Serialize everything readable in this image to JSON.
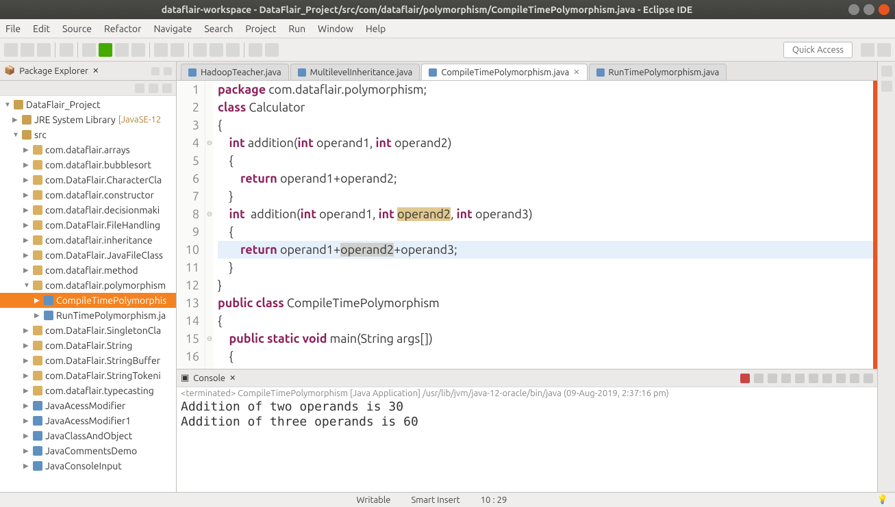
{
  "titlebar": {
    "title": "dataflair-workspace - DataFlair_Project/src/com/dataflair/polymorphism/CompileTimePolymorphism.java - Eclipse IDE"
  },
  "menubar": [
    "File",
    "Edit",
    "Source",
    "Refactor",
    "Navigate",
    "Search",
    "Project",
    "Run",
    "Window",
    "Help"
  ],
  "quick_access": "Quick Access",
  "package_explorer": {
    "title": "Package Explorer",
    "project": "DataFlair_Project",
    "jre": "JRE System Library",
    "jre_hint": "[JavaSE-12",
    "src": "src",
    "packages": [
      "com.dataflair.arrays",
      "com.dataflair.bubblesort",
      "com.DataFlair.CharacterCla",
      "com.dataflair.constructor",
      "com.dataflair.decisionmaki",
      "com.DataFlair.FileHandling",
      "com.dataflair.inheritance",
      "com.DataFlair.JavaFileClass",
      "com.dataflair.method",
      "com.dataflair.polymorphism"
    ],
    "polymorphism_files": [
      "CompileTimePolymorphis",
      "RunTimePolymorphism.ja"
    ],
    "packages_after": [
      "com.DataFlair.SingletonCla",
      "com.DataFlair.String",
      "com.DataFlair.StringBuffer",
      "com.DataFlair.StringTokeni",
      "com.dataflair.typecasting"
    ],
    "classes": [
      "JavaAcessModifier",
      "JavaAcessModifier1",
      "JavaClassAndObject",
      "JavaCommentsDemo",
      "JavaConsoleInput"
    ]
  },
  "editor": {
    "tabs": [
      {
        "label": "HadoopTeacher.java",
        "active": false
      },
      {
        "label": "MultilevelInheritance.java",
        "active": false
      },
      {
        "label": "CompileTimePolymorphism.java",
        "active": true
      },
      {
        "label": "RunTimePolymorphism.java",
        "active": false
      }
    ],
    "lines": [
      "1",
      "2",
      "3",
      "4",
      "5",
      "6",
      "7",
      "8",
      "9",
      "10",
      "11",
      "12",
      "13",
      "14",
      "15",
      "16"
    ],
    "code": {
      "l1_pkg": "package",
      "l1_path": "com.dataflair.polymorphism;",
      "l2_class": "class",
      "l2_name": "Calculator",
      "l3": "{",
      "l4_int": "int",
      "l4_m": "addition(",
      "l4_t1": "int",
      "l4_p1": " operand1, ",
      "l4_t2": "int",
      "l4_p2": " operand2)",
      "l5": "    {",
      "l6_ret": "return",
      "l6_expr": " operand1+operand2;",
      "l7": "    }",
      "l8_int": "int",
      "l8_m": " addition(",
      "l8_t1": "int",
      "l8_p1": " operand1, ",
      "l8_t2": "int",
      "l8_p2s": " ",
      "l8_p2": "operand2",
      "l8_c": ", ",
      "l8_t3": "int",
      "l8_p3": " operand3)",
      "l9": "    {",
      "l10_ret": "return",
      "l10_a": " operand1+",
      "l10_b": "operand2",
      "l10_c": "+operand3;",
      "l11": "    }",
      "l12": "}",
      "l13_pub": "public",
      "l13_cls": "class",
      "l13_name": " CompileTimePolymorphism",
      "l14": "{",
      "l15_pub": "public",
      "l15_stat": "static",
      "l15_void": "void",
      "l15_sig": " main(String args[])",
      "l16": "    {"
    }
  },
  "console": {
    "title": "Console",
    "term": "<terminated> CompileTimePolymorphism [Java Application] /usr/lib/jvm/java-12-oracle/bin/java (09-Aug-2019, 2:37:16 pm)",
    "output": "Addition of two operands is 30\nAddition of three operands is 60"
  },
  "statusbar": {
    "writable": "Writable",
    "insert": "Smart Insert",
    "pos": "10 : 29"
  }
}
